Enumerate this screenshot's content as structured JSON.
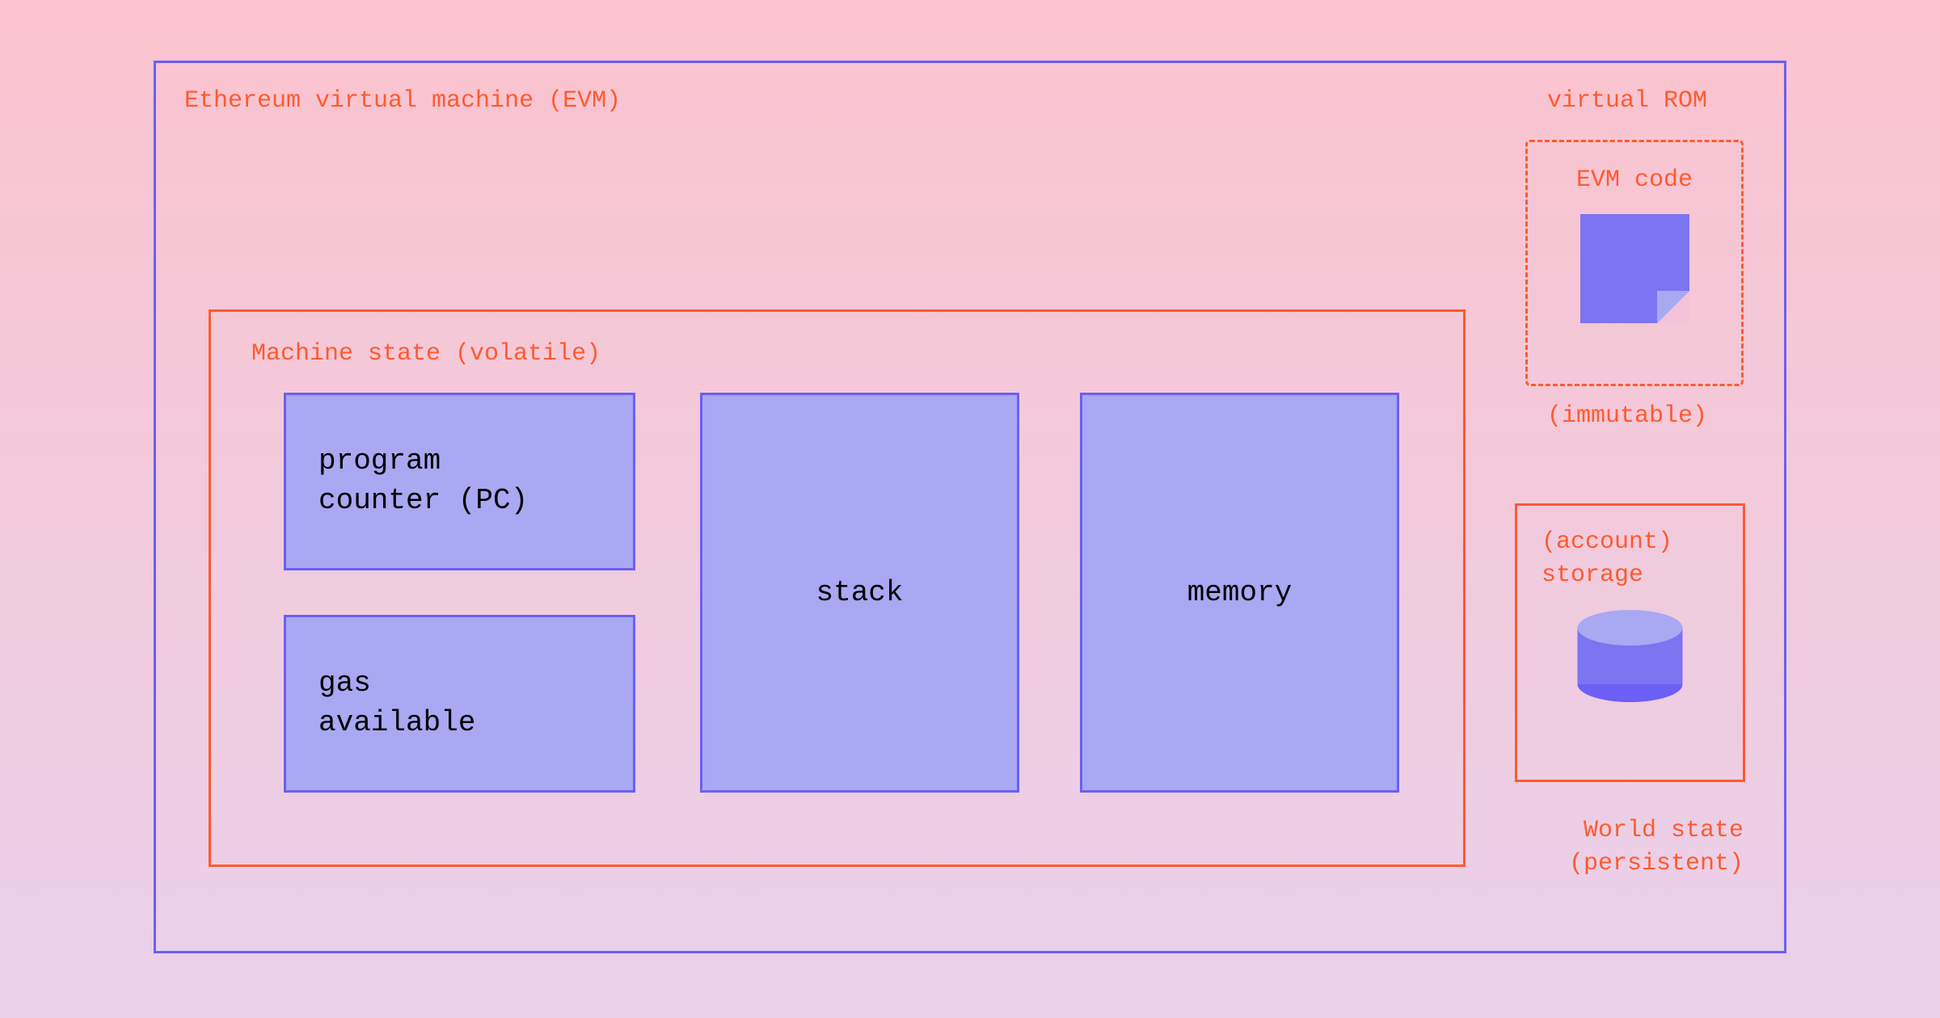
{
  "evm": {
    "title": "Ethereum virtual machine (EVM)",
    "machine_state": {
      "title": "Machine state (volatile)",
      "program_counter": "program\ncounter (PC)",
      "gas": "gas\navailable",
      "stack": "stack",
      "memory": "memory"
    },
    "virtual_rom": {
      "label": "virtual ROM",
      "code_label": "EVM code",
      "immutable": "(immutable)"
    },
    "storage": {
      "label": "(account)\nstorage"
    },
    "world_state": "World state\n(persistent)"
  }
}
